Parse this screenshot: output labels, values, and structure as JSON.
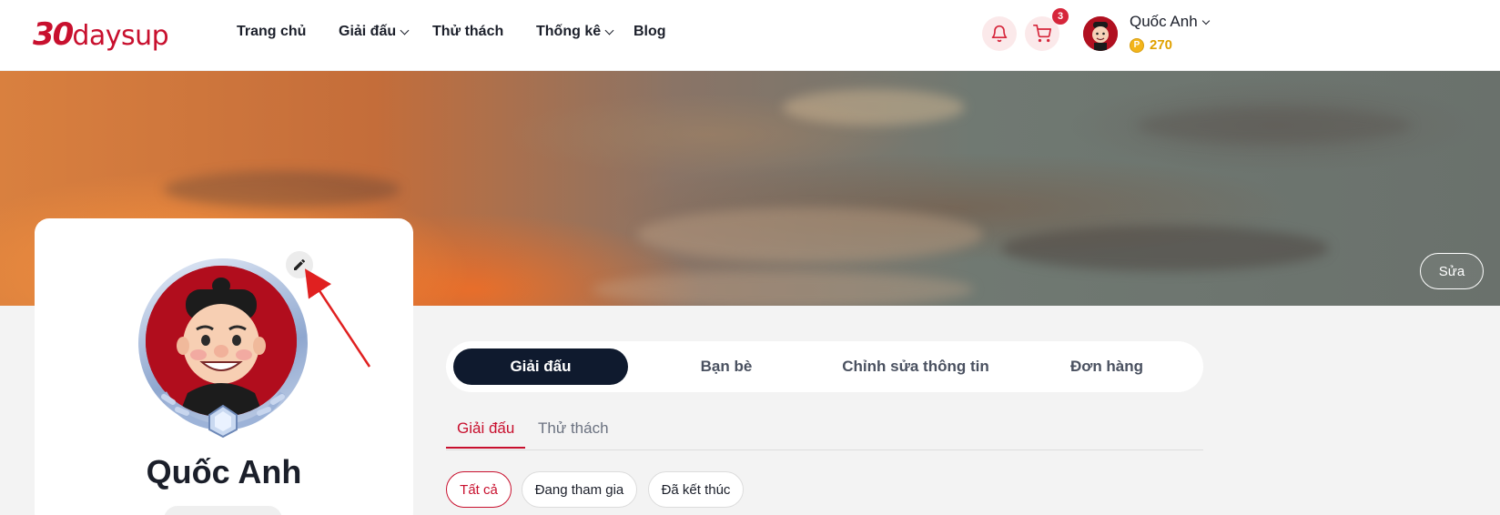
{
  "header": {
    "logo_number": "30",
    "logo_word": "daysup",
    "nav": [
      {
        "label": "Trang chủ"
      },
      {
        "label": "Giải đấu"
      },
      {
        "label": "Thử thách"
      },
      {
        "label": "Thống kê"
      },
      {
        "label": "Blog"
      }
    ],
    "cart_count": "3",
    "user_name": "Quốc Anh",
    "coins": "270"
  },
  "cover": {
    "edit_label": "Sửa"
  },
  "profile": {
    "name": "Quốc Anh"
  },
  "tabs": [
    {
      "label": "Giải đấu"
    },
    {
      "label": "Bạn bè"
    },
    {
      "label": "Chỉnh sửa thông tin"
    },
    {
      "label": "Đơn hàng"
    }
  ],
  "subtabs": [
    {
      "label": "Giải đấu"
    },
    {
      "label": "Thử thách"
    }
  ],
  "filters": [
    {
      "label": "Tất cả"
    },
    {
      "label": "Đang tham gia"
    },
    {
      "label": "Đã kết thúc"
    }
  ],
  "colors": {
    "brand": "#c8102e",
    "dark_tab": "#0f1a2e",
    "coin": "#e0a100"
  }
}
